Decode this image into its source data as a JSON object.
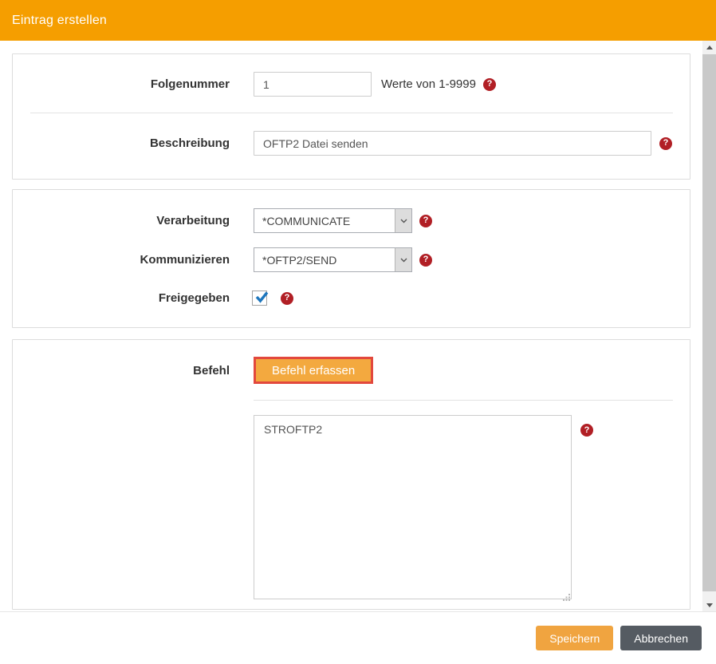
{
  "header": {
    "title": "Eintrag erstellen"
  },
  "colors": {
    "header_bg": "#f59e00",
    "primary_button": "#f0a440",
    "cancel_button": "#555b62",
    "befehl_button_bg": "#f3a93f",
    "befehl_button_border": "#e2483d",
    "help_badge": "#b11f25",
    "checkbox_check": "#1e76bd"
  },
  "icons": {
    "help_glyph": "?"
  },
  "form": {
    "folgenummer": {
      "label": "Folgenummer",
      "value": "1",
      "hint": "Werte von 1-9999"
    },
    "beschreibung": {
      "label": "Beschreibung",
      "value": "OFTP2 Datei senden"
    },
    "verarbeitung": {
      "label": "Verarbeitung",
      "value": "*COMMUNICATE"
    },
    "kommunizieren": {
      "label": "Kommunizieren",
      "value": "*OFTP2/SEND"
    },
    "freigegeben": {
      "label": "Freigegeben",
      "checked": true
    },
    "befehl": {
      "label": "Befehl",
      "button_label": "Befehl erfassen",
      "command_value": "STROFTP2"
    }
  },
  "footer": {
    "save_label": "Speichern",
    "cancel_label": "Abbrechen"
  }
}
